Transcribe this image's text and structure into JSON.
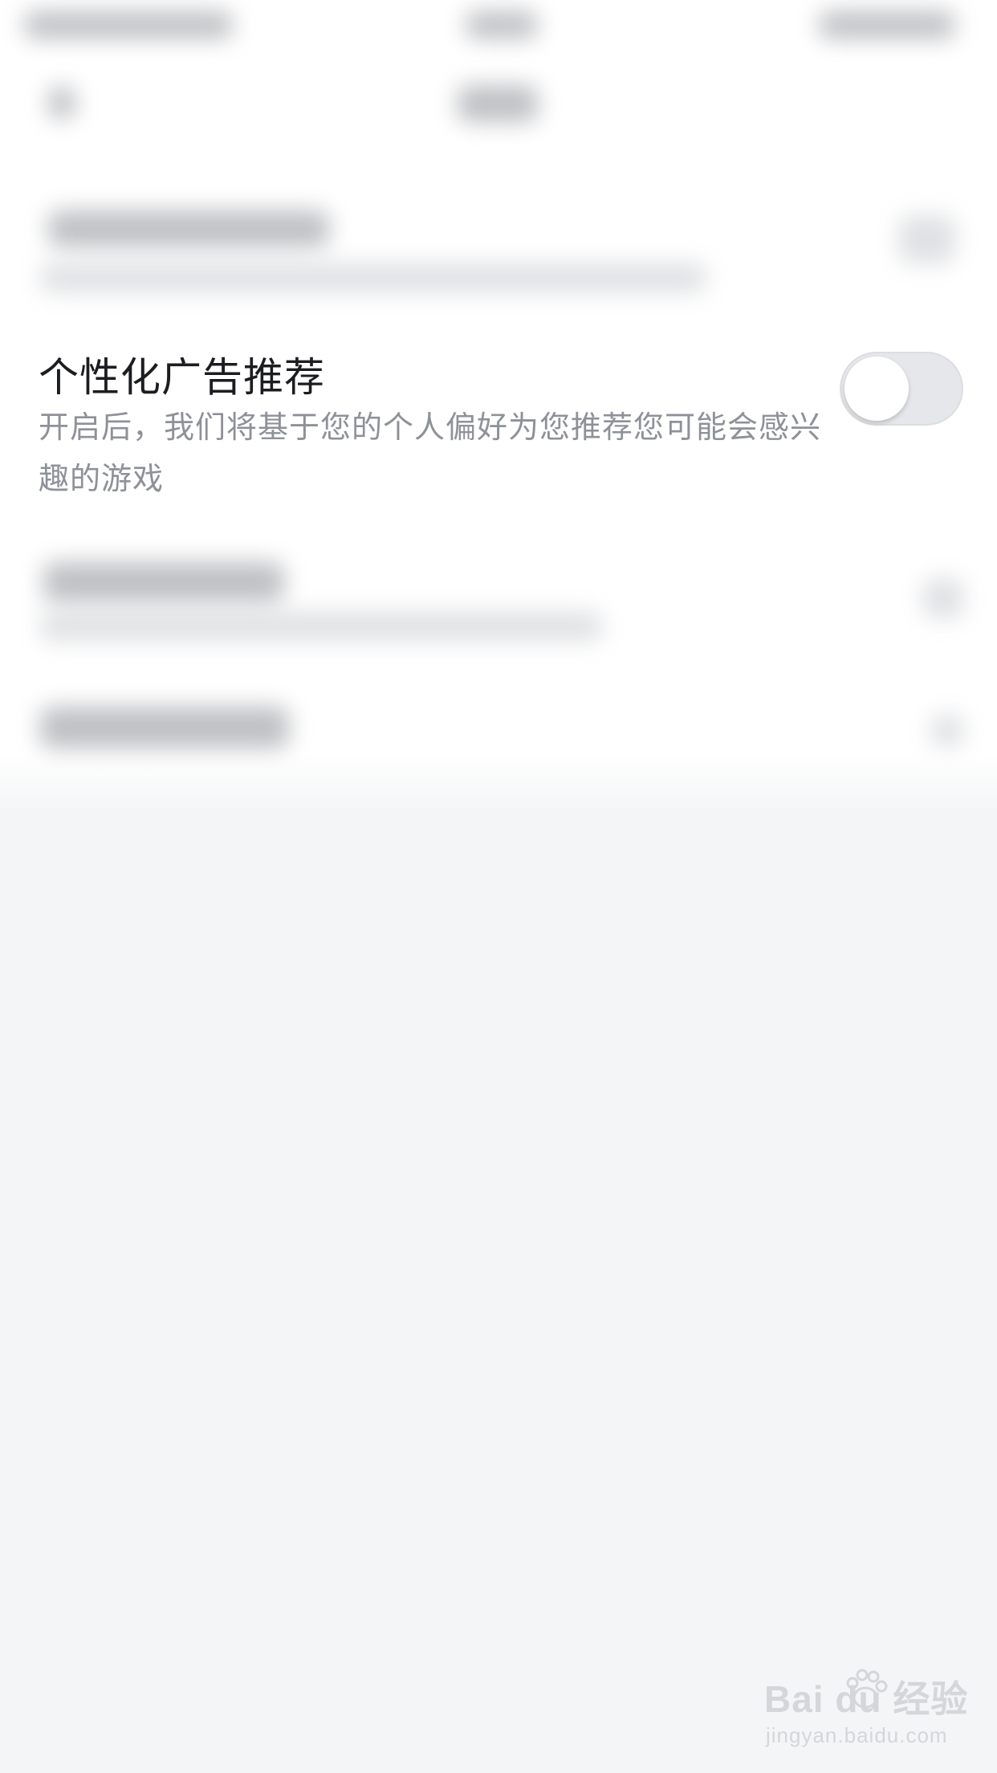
{
  "setting": {
    "title": "个性化广告推荐",
    "description": "开启后，我们将基于您的个人偏好为您推荐您可能会感兴趣的游戏",
    "toggle_state": "off"
  },
  "watermark": {
    "logo_text": "Bai du 经验",
    "url": "jingyan.baidu.com"
  },
  "colors": {
    "background": "#f4f5f7",
    "panel": "#ffffff",
    "title_text": "#1c1d20",
    "desc_text": "#8e9198",
    "toggle_track": "#e6e7ea"
  }
}
